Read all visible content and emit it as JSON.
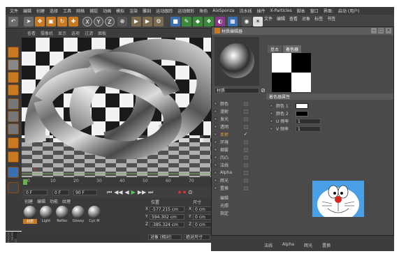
{
  "menu": [
    "文件",
    "编辑",
    "创建",
    "选择",
    "工具",
    "网格",
    "捕捉",
    "动画",
    "模拟",
    "渲染",
    "雕刻",
    "运动跟踪",
    "运动图形",
    "角色",
    "AixSponza",
    "流水线",
    "插件",
    "X-Particles",
    "脚本",
    "窗口",
    "界面:",
    "启动 (用户)"
  ],
  "viewport": {
    "menu": [
      "查看",
      "摄像机",
      "显示",
      "选项",
      "过滤",
      "面板"
    ]
  },
  "timeline": {
    "ticks": [
      "0",
      "10",
      "20",
      "30",
      "40",
      "50",
      "60",
      "70",
      "80"
    ]
  },
  "transport": {
    "start": "0 F",
    "frame": "0 F",
    "end": "90 F"
  },
  "material_manager": {
    "menu": [
      "创建",
      "编辑",
      "功能",
      "纹理"
    ],
    "materials": [
      "材质",
      "Light",
      "Reflec",
      "Glossy",
      "Cyc M"
    ]
  },
  "coordinates": {
    "headers": [
      "位置",
      "尺寸"
    ],
    "rows": [
      {
        "axis": "X",
        "pos": "-577.215 cm",
        "size": "0 cm"
      },
      {
        "axis": "Y",
        "pos": "594.302 cm",
        "size": "0 cm"
      },
      {
        "axis": "Z",
        "pos": "-385.324 cm",
        "size": "0 cm"
      }
    ],
    "mode": "对象 (相对)",
    "size_mode": "绝对尺寸"
  },
  "material_editor": {
    "title": "材质编辑器",
    "menu": [
      "文件",
      "编辑",
      "查看",
      "对象",
      "标签",
      "书签"
    ],
    "tabs": [
      "基本",
      "着色器"
    ],
    "material_name": "材质",
    "section": "着色器属性",
    "channels": [
      {
        "name": "颜色",
        "checked": false
      },
      {
        "name": "漫射",
        "checked": false
      },
      {
        "name": "发光",
        "checked": false
      },
      {
        "name": "透明",
        "checked": false
      },
      {
        "name": "反射",
        "checked": true
      },
      {
        "name": "环境",
        "checked": false
      },
      {
        "name": "烟雾",
        "checked": false
      },
      {
        "name": "凹凸",
        "checked": false
      },
      {
        "name": "法线",
        "checked": false
      },
      {
        "name": "Alpha",
        "checked": false
      },
      {
        "name": "辉光",
        "checked": false
      },
      {
        "name": "置换",
        "checked": false
      }
    ],
    "extra": [
      "编辑",
      "光照",
      "指定"
    ],
    "props": [
      {
        "label": "颜色 1",
        "value": ""
      },
      {
        "label": "颜色 2",
        "value": ""
      },
      {
        "label": "U 频率",
        "value": "1"
      },
      {
        "label": "V 频率",
        "value": "1"
      }
    ]
  },
  "bottom_strip": [
    "法线",
    "Alpha",
    "辉光",
    "置换"
  ],
  "colors": {
    "accent": "#c77a22",
    "active_channel": "#e8a040",
    "panel": "#4a4a4a"
  }
}
